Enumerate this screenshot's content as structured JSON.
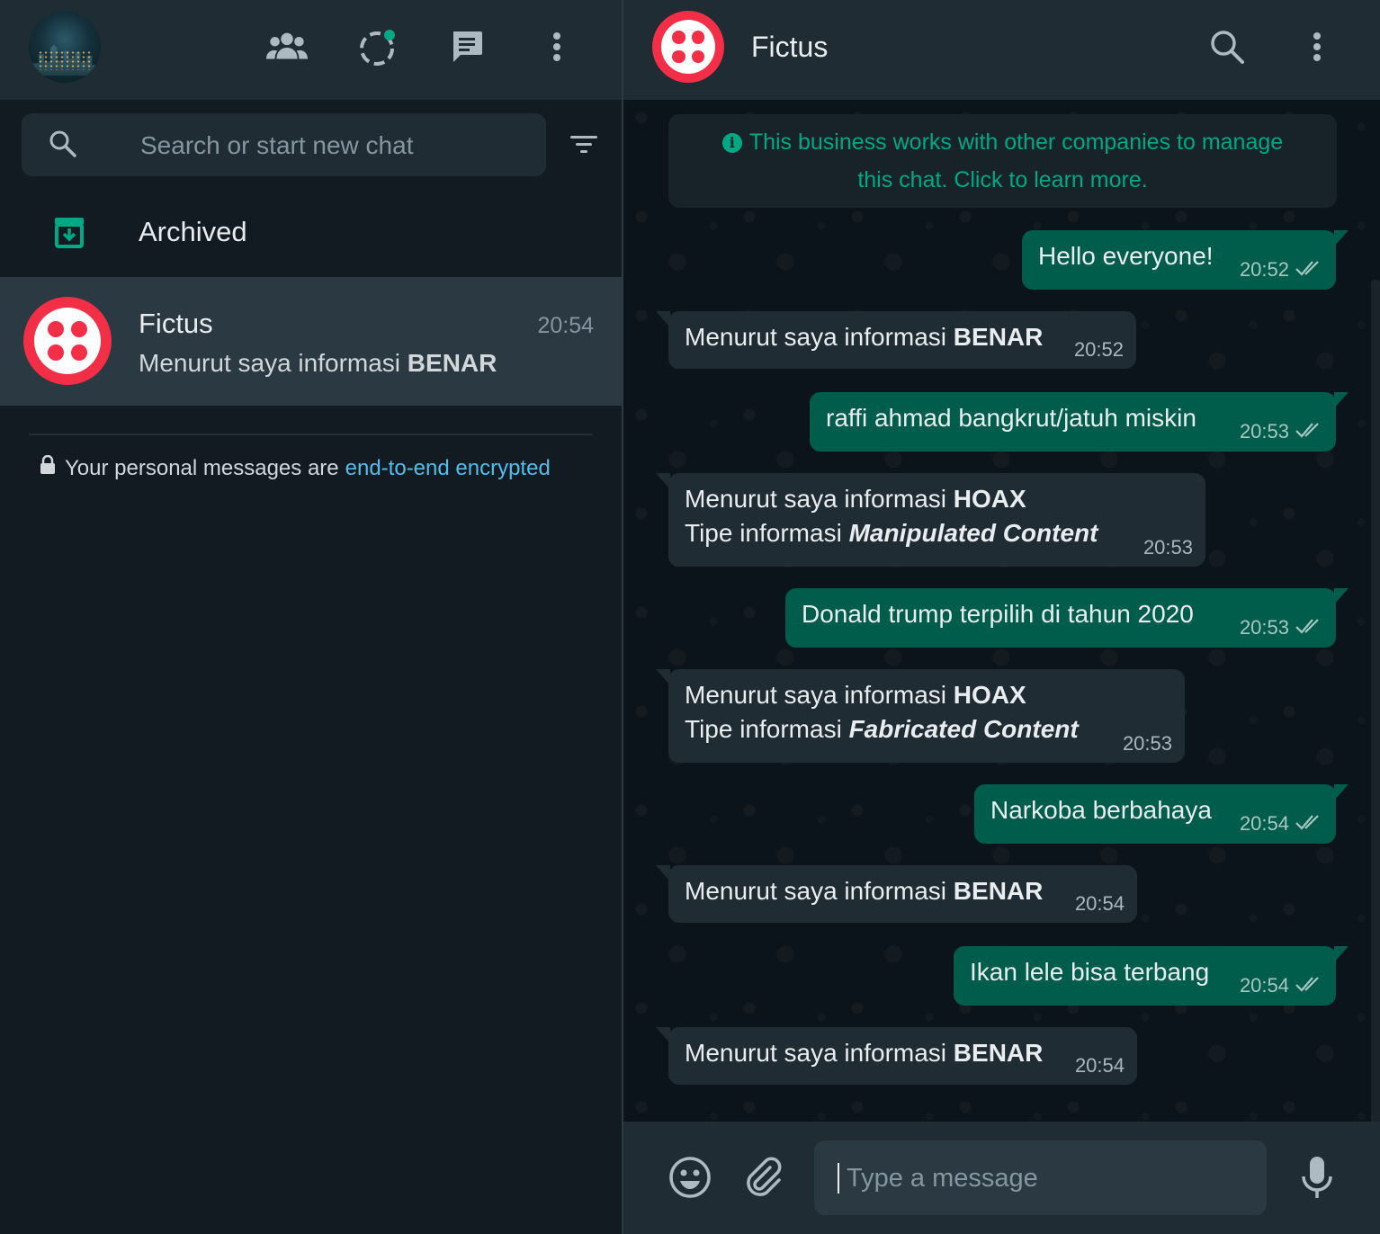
{
  "sidebar": {
    "icons": [
      "communities-icon",
      "status-icon",
      "new-chat-icon",
      "menu-icon"
    ],
    "search": {
      "placeholder": "Search or start new chat"
    },
    "archived_label": "Archived",
    "chats": [
      {
        "name": "Fictus",
        "time": "20:54",
        "preview_prefix": "Menurut saya informasi ",
        "preview_bold": "BENAR"
      }
    ],
    "encryption": {
      "text": "Your personal messages are",
      "link": "end-to-end encrypted"
    }
  },
  "chat": {
    "title": "Fictus",
    "notice": {
      "line1": "This business works with other companies to manage",
      "line2": "this chat. Click to learn more."
    },
    "messages": [
      {
        "dir": "out",
        "text": "Hello everyone!",
        "time": "20:52"
      },
      {
        "dir": "in",
        "prefix": "Menurut saya informasi ",
        "bold": "BENAR",
        "time": "20:52"
      },
      {
        "dir": "out",
        "text": "raffi ahmad bangkrut/jatuh miskin",
        "time": "20:53"
      },
      {
        "dir": "in",
        "prefix": "Menurut saya informasi ",
        "bold": "HOAX",
        "line2_prefix": "Tipe informasi ",
        "line2_bold": "Manipulated Content",
        "time": "20:53"
      },
      {
        "dir": "out",
        "text": "Donald trump terpilih di tahun 2020",
        "time": "20:53"
      },
      {
        "dir": "in",
        "prefix": "Menurut saya informasi ",
        "bold": "HOAX",
        "line2_prefix": "Tipe informasi ",
        "line2_bold": "Fabricated Content",
        "time": "20:53"
      },
      {
        "dir": "out",
        "text": "Narkoba berbahaya",
        "time": "20:54"
      },
      {
        "dir": "in",
        "prefix": "Menurut saya informasi ",
        "bold": "BENAR",
        "time": "20:54"
      },
      {
        "dir": "out",
        "text": "Ikan lele bisa terbang",
        "time": "20:54"
      },
      {
        "dir": "in",
        "prefix": "Menurut saya informasi ",
        "bold": "BENAR",
        "time": "20:54"
      }
    ],
    "composer": {
      "placeholder": "Type a message"
    }
  },
  "colors": {
    "accent": "#00a884",
    "outgoing": "#005c4b",
    "incoming": "#202c33",
    "brand": "#f22f46",
    "link": "#53bdeb"
  }
}
